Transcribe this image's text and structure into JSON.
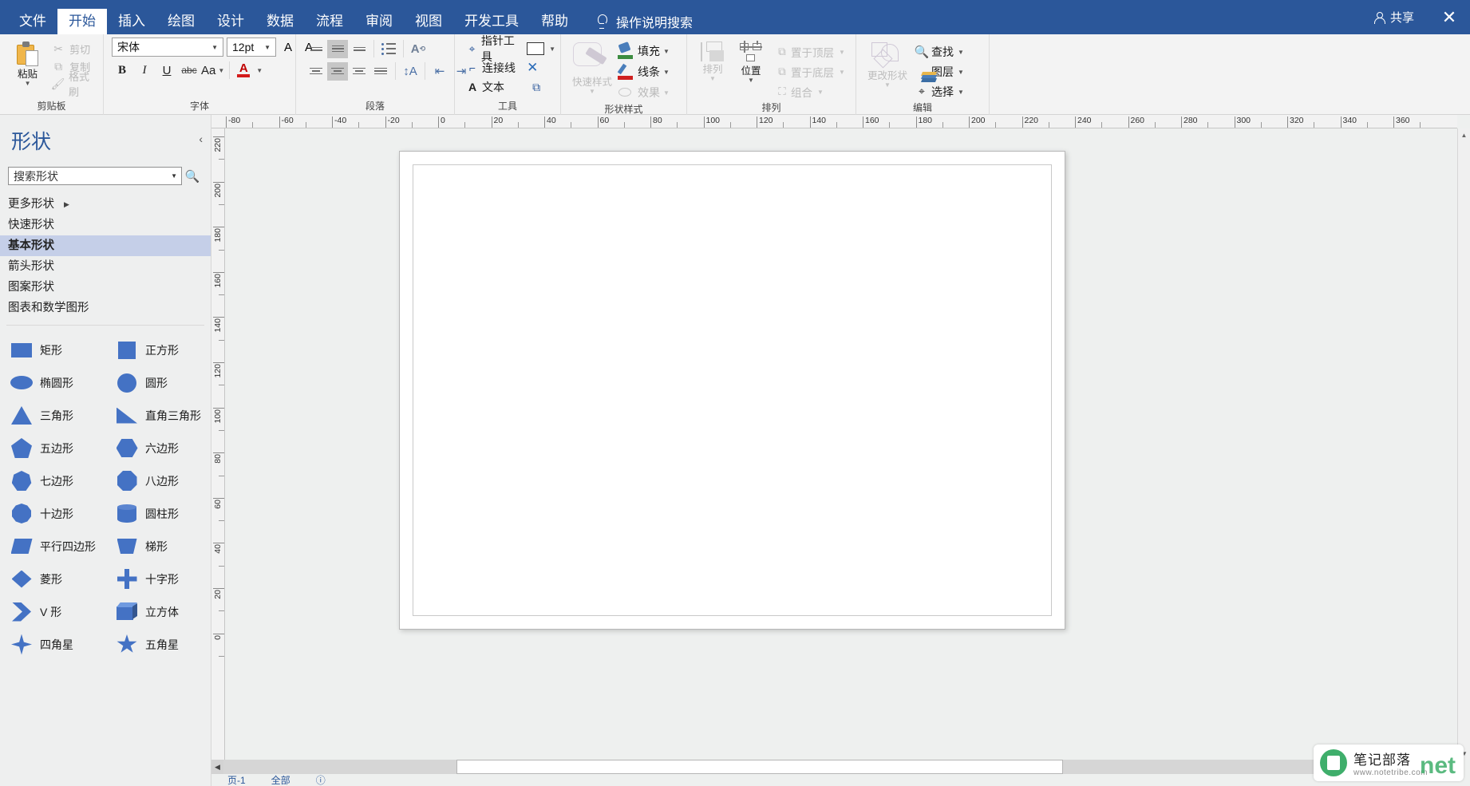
{
  "titlebar": {
    "tabs": [
      {
        "label": "文件",
        "active": false
      },
      {
        "label": "开始",
        "active": true
      },
      {
        "label": "插入",
        "active": false
      },
      {
        "label": "绘图",
        "active": false
      },
      {
        "label": "设计",
        "active": false
      },
      {
        "label": "数据",
        "active": false
      },
      {
        "label": "流程",
        "active": false
      },
      {
        "label": "审阅",
        "active": false
      },
      {
        "label": "视图",
        "active": false
      },
      {
        "label": "开发工具",
        "active": false
      },
      {
        "label": "帮助",
        "active": false
      }
    ],
    "tell_me": "操作说明搜索",
    "share": "共享",
    "close": "✕",
    "accent": "#2b579a"
  },
  "ribbon": {
    "groups": [
      {
        "name": "clipboard",
        "label": "剪贴板"
      },
      {
        "name": "font",
        "label": "字体"
      },
      {
        "name": "paragraph",
        "label": "段落"
      },
      {
        "name": "tools",
        "label": "工具"
      },
      {
        "name": "shape_styles",
        "label": "形状样式"
      },
      {
        "name": "arrange",
        "label": "排列"
      },
      {
        "name": "editing",
        "label": "编辑"
      }
    ],
    "clipboard": {
      "paste": "粘贴",
      "cut": "剪切",
      "copy": "复制",
      "format_painter": "格式刷"
    },
    "font": {
      "family": "宋体",
      "size": "12pt",
      "grow": "A",
      "shrink": "A",
      "bold": "B",
      "italic": "I",
      "underline": "U",
      "strike": "abc",
      "case": "Aa",
      "color_letter": "A",
      "color_hex": "#d41c1c"
    },
    "tools": {
      "pointer": "指针工具",
      "connector": "连接线",
      "text": "文本"
    },
    "shape_styles": {
      "quick_styles": "快速样式",
      "fill": "填充",
      "line": "线条",
      "effects": "效果"
    },
    "arrange": {
      "arrange": "排列",
      "position": "位置",
      "bring_front": "置于顶层",
      "send_back": "置于底层",
      "group": "组合"
    },
    "editing": {
      "change_shape": "更改形状",
      "find": "查找",
      "layers": "图层",
      "select": "选择"
    }
  },
  "shapes_panel": {
    "title": "形状",
    "collapse": "‹",
    "search_placeholder": "搜索形状",
    "search_value": "搜索形状",
    "categories": [
      {
        "label": "更多形状",
        "selected": false,
        "has_chevron": true
      },
      {
        "label": "快速形状",
        "selected": false,
        "has_chevron": false
      },
      {
        "label": "基本形状",
        "selected": true,
        "has_chevron": false
      },
      {
        "label": "箭头形状",
        "selected": false,
        "has_chevron": false
      },
      {
        "label": "图案形状",
        "selected": false,
        "has_chevron": false
      },
      {
        "label": "图表和数学图形",
        "selected": false,
        "has_chevron": false
      }
    ],
    "shape_color": "#4472c4",
    "shapes": [
      {
        "name": "矩形",
        "icon": "rectangle-shape-icon"
      },
      {
        "name": "正方形",
        "icon": "square-shape-icon"
      },
      {
        "name": "椭圆形",
        "icon": "ellipse-shape-icon"
      },
      {
        "name": "圆形",
        "icon": "circle-shape-icon"
      },
      {
        "name": "三角形",
        "icon": "triangle-shape-icon"
      },
      {
        "name": "直角三角形",
        "icon": "right-triangle-shape-icon"
      },
      {
        "name": "五边形",
        "icon": "pentagon-shape-icon"
      },
      {
        "name": "六边形",
        "icon": "hexagon-shape-icon"
      },
      {
        "name": "七边形",
        "icon": "heptagon-shape-icon"
      },
      {
        "name": "八边形",
        "icon": "octagon-shape-icon"
      },
      {
        "name": "十边形",
        "icon": "decagon-shape-icon"
      },
      {
        "name": "圆柱形",
        "icon": "cylinder-shape-icon"
      },
      {
        "name": "平行四边形",
        "icon": "parallelogram-shape-icon"
      },
      {
        "name": "梯形",
        "icon": "trapezoid-shape-icon"
      },
      {
        "name": "菱形",
        "icon": "diamond-shape-icon"
      },
      {
        "name": "十字形",
        "icon": "cross-shape-icon"
      },
      {
        "name": "V 形",
        "icon": "chevron-shape-icon"
      },
      {
        "name": "立方体",
        "icon": "cube-shape-icon"
      },
      {
        "name": "四角星",
        "icon": "four-point-star-shape-icon"
      },
      {
        "name": "五角星",
        "icon": "five-point-star-shape-icon"
      }
    ]
  },
  "canvas": {
    "h_ruler_labels": [
      "-80",
      "-60",
      "-40",
      "-20",
      "0",
      "20",
      "40",
      "60",
      "80",
      "100",
      "120",
      "140",
      "160",
      "180",
      "200",
      "220",
      "240",
      "260",
      "280",
      "300",
      "320",
      "340",
      "360"
    ],
    "v_ruler_labels": [
      "220",
      "200",
      "180",
      "160",
      "140",
      "120",
      "100",
      "80",
      "60",
      "40",
      "20",
      "0"
    ]
  },
  "statusbar": {
    "page": "页-1",
    "all": "全部",
    "info": "ⓘ"
  },
  "watermark": {
    "line1": "笔记部落",
    "line2": "www.notetribe.com",
    "badge": "net"
  }
}
